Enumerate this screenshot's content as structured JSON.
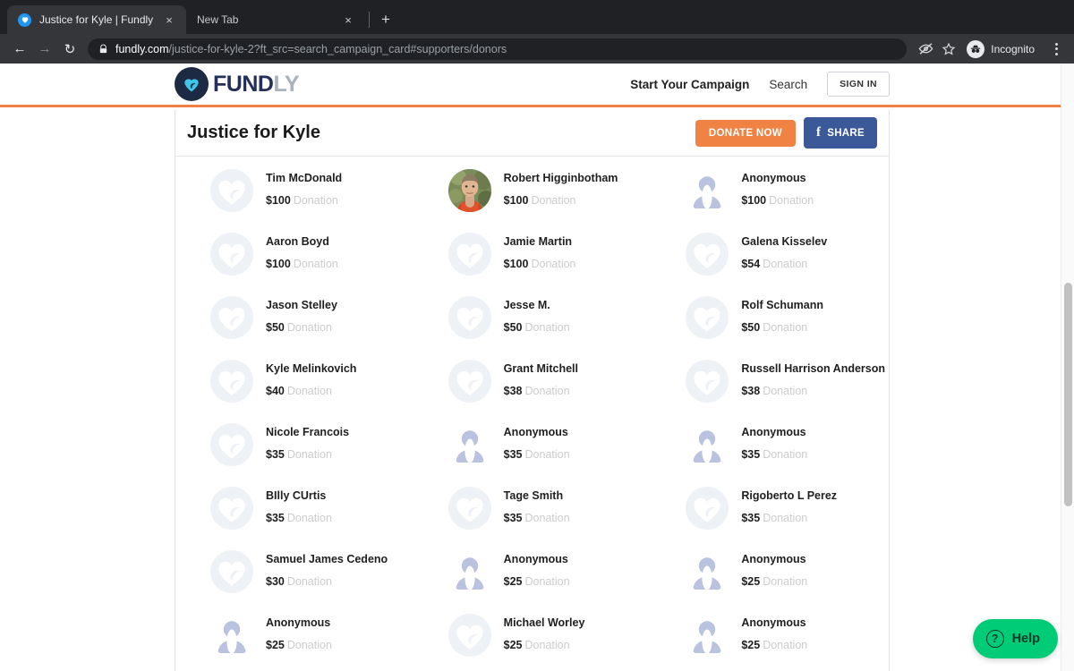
{
  "browser": {
    "tabs": [
      {
        "title": "Justice for Kyle | Fundly",
        "favicon": "heart-favicon",
        "close_label": "×",
        "active": true
      },
      {
        "title": "New Tab",
        "close_label": "×",
        "active": false
      }
    ],
    "new_tab_label": "+",
    "back_label": "←",
    "forward_label": "→",
    "reload_label": "↻",
    "url_host": "fundly.com",
    "url_path": "/justice-for-kyle-2?ft_src=search_campaign_card#supporters/donors",
    "incognito_label": "Incognito",
    "lock_icon": "lock-icon",
    "eye_icon": "eye-crossed-icon",
    "star_icon": "star-icon",
    "menu_icon": "kebab-menu-icon"
  },
  "site": {
    "logo_text_a": "FUND",
    "logo_text_b": "LY",
    "accent_color": "#ef7f42",
    "nav": [
      {
        "label": "Start Your Campaign",
        "bold": true
      },
      {
        "label": "Search",
        "bold": false
      }
    ],
    "signin_label": "SIGN IN"
  },
  "campaign": {
    "title": "Justice for Kyle",
    "donate_label": "DONATE NOW",
    "share_label": "SHARE",
    "donate_color": "#f08244",
    "share_color": "#3b5998"
  },
  "donation_label": "Donation",
  "donors": [
    {
      "name": "Tim McDonald",
      "amount": "$100",
      "avatar": "heart"
    },
    {
      "name": "Robert Higginbotham",
      "amount": "$100",
      "avatar": "photo"
    },
    {
      "name": "Anonymous",
      "amount": "$100",
      "avatar": "anon"
    },
    {
      "name": "Aaron Boyd",
      "amount": "$100",
      "avatar": "heart"
    },
    {
      "name": "Jamie Martin",
      "amount": "$100",
      "avatar": "heart"
    },
    {
      "name": "Galena Kisselev",
      "amount": "$54",
      "avatar": "heart"
    },
    {
      "name": "Jason Stelley",
      "amount": "$50",
      "avatar": "heart"
    },
    {
      "name": "Jesse M.",
      "amount": "$50",
      "avatar": "heart"
    },
    {
      "name": "Rolf Schumann",
      "amount": "$50",
      "avatar": "heart"
    },
    {
      "name": "Kyle Melinkovich",
      "amount": "$40",
      "avatar": "heart"
    },
    {
      "name": "Grant Mitchell",
      "amount": "$38",
      "avatar": "heart"
    },
    {
      "name": "Russell Harrison Anderson",
      "amount": "$38",
      "avatar": "heart"
    },
    {
      "name": "Nicole Francois",
      "amount": "$35",
      "avatar": "heart"
    },
    {
      "name": "Anonymous",
      "amount": "$35",
      "avatar": "anon"
    },
    {
      "name": "Anonymous",
      "amount": "$35",
      "avatar": "anon"
    },
    {
      "name": "BIlly CUrtis",
      "amount": "$35",
      "avatar": "heart"
    },
    {
      "name": "Tage Smith",
      "amount": "$35",
      "avatar": "heart"
    },
    {
      "name": "Rigoberto L Perez",
      "amount": "$35",
      "avatar": "heart"
    },
    {
      "name": "Samuel James Cedeno",
      "amount": "$30",
      "avatar": "heart"
    },
    {
      "name": "Anonymous",
      "amount": "$25",
      "avatar": "anon"
    },
    {
      "name": "Anonymous",
      "amount": "$25",
      "avatar": "anon"
    },
    {
      "name": "Anonymous",
      "amount": "$25",
      "avatar": "anon"
    },
    {
      "name": "Michael Worley",
      "amount": "$25",
      "avatar": "heart"
    },
    {
      "name": "Anonymous",
      "amount": "$25",
      "avatar": "anon"
    }
  ],
  "help": {
    "label": "Help",
    "icon": "question-circle-icon",
    "color": "#00cc77"
  }
}
